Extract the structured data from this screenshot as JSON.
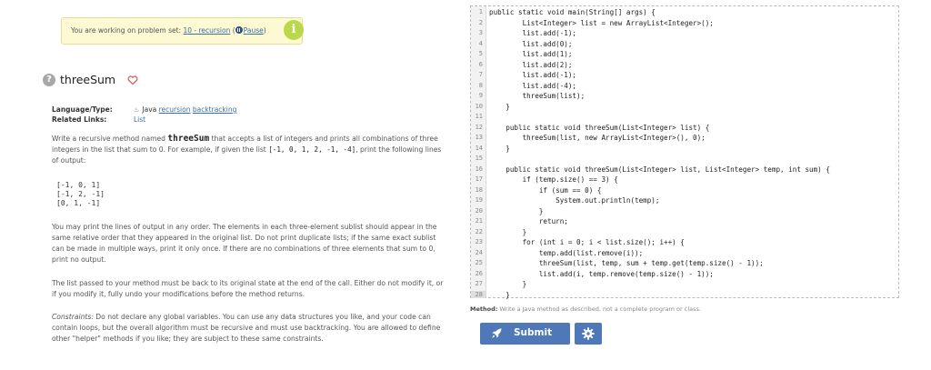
{
  "notice": {
    "prefix": "You are working on problem set: ",
    "set_link": "10 - recursion",
    "open_paren": " (",
    "pause_label": "Pause",
    "close_paren": ")",
    "info_icon_text": "i"
  },
  "problem": {
    "help_icon_text": "?",
    "title": "threeSum"
  },
  "meta": {
    "language_type_label": "Language/Type:",
    "language": "Java",
    "tag_1": "recursion",
    "tag_2": "backtracking",
    "related_label": "Related Links:",
    "related_value": "List"
  },
  "description": {
    "p1_a": "Write a recursive method named ",
    "p1_method": "threeSum",
    "p1_b": " that accepts a list of integers and prints all combinations of three integers in the list that sum to 0. For example, if given the list ",
    "p1_list": "[-1, 0, 1, 2, -1, -4]",
    "p1_c": ", print the following lines of output:",
    "output_lines": [
      "[-1, 0, 1]",
      "[-1, 2, -1]",
      "[0, 1, -1]"
    ],
    "p2": "You may print the lines of output in any order. The elements in each three-element sublist should appear in the same relative order that they appeared in the original list. Do not print duplicate lists; if the same exact sublist can be made in multiple ways, print it only once. If there are no combinations of three elements that sum to 0, print no output.",
    "p3": "The list passed to your method must be back to its original state at the end of the call. Either do not modify it, or if you modify it, fully undo your modifications before the method returns.",
    "p4_label": "Constraints:",
    "p4": " Do not declare any global variables. You can use any data structures you like, and your code can contain loops, but the overall algorithm must be recursive and must use backtracking. You are allowed to define other \"helper\" methods if you like; they are subject to these same constraints."
  },
  "editor": {
    "line_numbers": [
      "1",
      "2",
      "3",
      "4",
      "5",
      "6",
      "7",
      "8",
      "9",
      "10",
      "11",
      "12",
      "13",
      "14",
      "15",
      "16",
      "17",
      "18",
      "19",
      "20",
      "21",
      "22",
      "23",
      "24",
      "25",
      "26",
      "27",
      "28"
    ],
    "lines": [
      "public static void main(String[] args) {",
      "        List<Integer> list = new ArrayList<Integer>();",
      "        list.add(-1);",
      "        list.add(0);",
      "        list.add(1);",
      "        list.add(2);",
      "        list.add(-1);",
      "        list.add(-4);",
      "        threeSum(list);",
      "    }",
      "",
      "    public static void threeSum(List<Integer> list) {",
      "        threeSum(list, new ArrayList<Integer>(), 0);",
      "    }",
      "",
      "    public static void threeSum(List<Integer> list, List<Integer> temp, int sum) {",
      "        if (temp.size() == 3) {",
      "            if (sum == 0) {",
      "                System.out.println(temp);",
      "            }",
      "            return;",
      "        }",
      "        for (int i = 0; i < list.size(); i++) {",
      "            temp.add(list.remove(i));",
      "            threeSum(list, temp, sum + temp.get(temp.size() - 1));",
      "            list.add(i, temp.remove(temp.size() - 1));",
      "        }",
      "    }"
    ]
  },
  "method_note": {
    "label": "Method:",
    "text": " Write a Java method as described, not a complete program or class."
  },
  "submit": {
    "label": "Submit"
  },
  "colors": {
    "accent": "#4f78b8",
    "notice_bg": "#fdf9d2",
    "info_badge": "#b9d84a"
  }
}
